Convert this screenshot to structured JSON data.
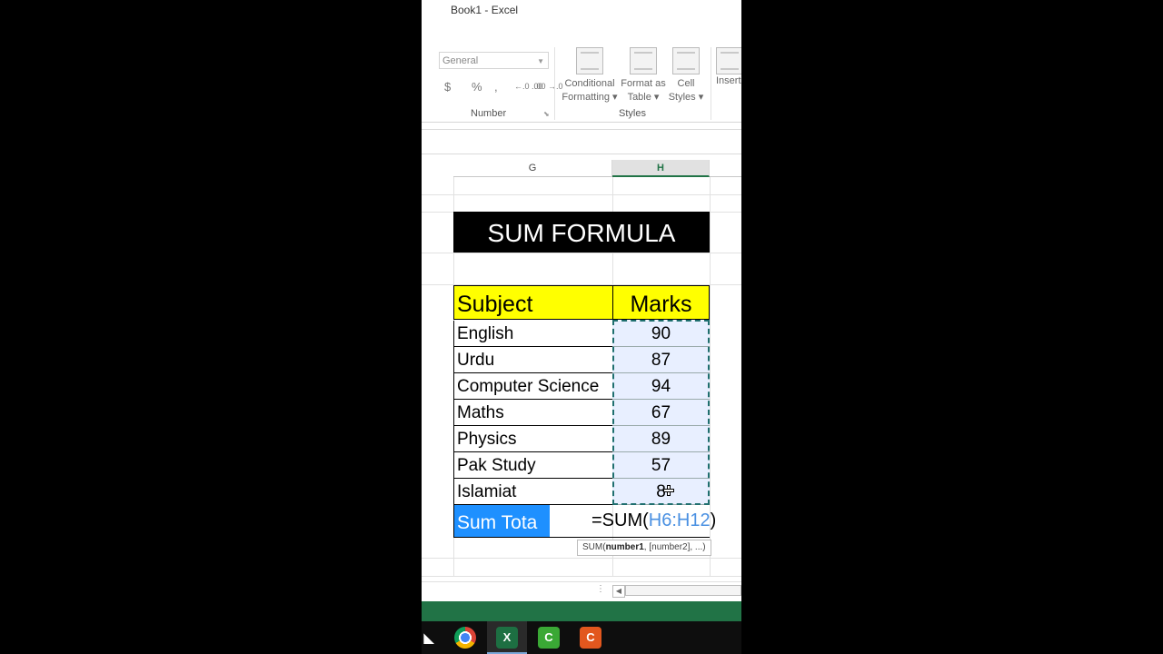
{
  "window": {
    "title": "Book1 - Excel"
  },
  "ribbon": {
    "number_format": "General",
    "number_buttons": [
      "$",
      "%",
      ",",
      "←.0 .00",
      ".00 →.0"
    ],
    "number_group_label": "Number",
    "styles_buttons": [
      {
        "label_1": "Conditional",
        "label_2": "Formatting ▾"
      },
      {
        "label_1": "Format as",
        "label_2": "Table ▾"
      },
      {
        "label_1": "Cell",
        "label_2": "Styles ▾"
      }
    ],
    "styles_group_label": "Styles",
    "insert_label": "Insert"
  },
  "grid": {
    "columns": [
      "G",
      "H"
    ],
    "selected_column": "H",
    "banner": "SUM FORMULA",
    "header": {
      "subject": "Subject",
      "marks": "Marks"
    },
    "rows": [
      {
        "subject": "English",
        "marks": "90"
      },
      {
        "subject": "Urdu",
        "marks": "87"
      },
      {
        "subject": "Computer Science",
        "marks": "94"
      },
      {
        "subject": "Maths",
        "marks": "67"
      },
      {
        "subject": "Physics",
        "marks": "89"
      },
      {
        "subject": "Pak Study",
        "marks": "57"
      },
      {
        "subject": "Islamiat",
        "marks": "8"
      }
    ],
    "sum_label": "Sum Tota",
    "formula": {
      "prefix": "=SUM(",
      "ref": "H6:H12",
      "suffix": ")"
    },
    "tooltip": {
      "func": "SUM(",
      "arg1": "number1",
      "rest": ", [number2], ...)"
    }
  },
  "colors": {
    "excel_green": "#217346",
    "banner_bg": "#000000",
    "header_bg": "#ffff00",
    "sum_label_bg": "#1e90ff",
    "ref_blue": "#4a90e2"
  },
  "taskbar": {
    "icons": [
      "chrome-icon",
      "excel-icon",
      "camtasia-icon",
      "recorder-icon"
    ]
  }
}
